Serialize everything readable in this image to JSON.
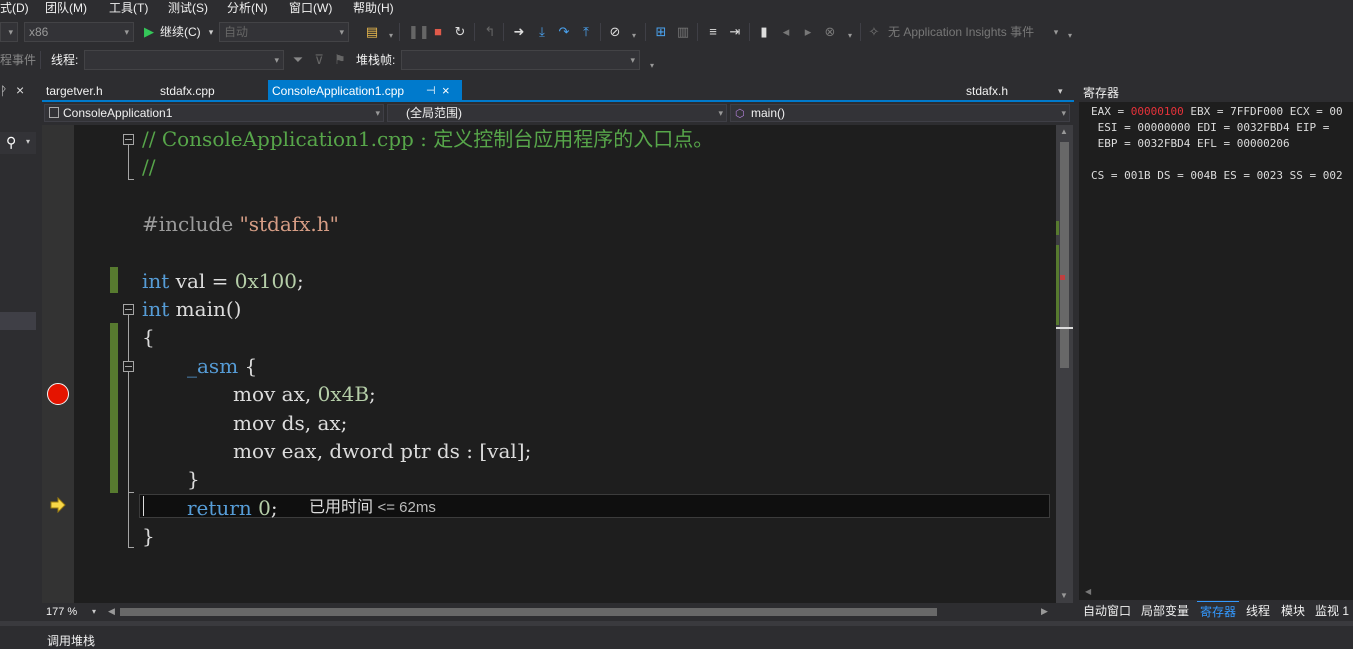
{
  "menu": [
    "式(D)",
    "团队(M)",
    "工具(T)",
    "测试(S)",
    "分析(N)",
    "窗口(W)",
    "帮助(H)"
  ],
  "toolbar": {
    "platform": "x86",
    "continue_label": "继续(C)",
    "config_placeholder": "自动",
    "insights_label": "无 Application Insights 事件"
  },
  "toolbar2": {
    "events_label": "程事件",
    "thread_label": "线程:",
    "stackframe_label": "堆栈帧:"
  },
  "tabs": {
    "items": [
      "targetver.h",
      "stdafx.cpp",
      "ConsoleApplication1.cpp"
    ],
    "active_pin": "⊣",
    "active_close": "×",
    "right_tab": "stdafx.h"
  },
  "nav": {
    "project": "ConsoleApplication1",
    "scope": "(全局范围)",
    "member": "main()"
  },
  "code": {
    "l1_comment": "// ConsoleApplication1.cpp : 定义控制台应用程序的入口点。",
    "l2_comment": "//",
    "l3_include": "#include",
    "l3_file": "\"stdafx.h\"",
    "l4_type": "int",
    "l4_rest": " val = ",
    "l4_num": "0x100",
    "l4_end": ";",
    "l5_type": "int",
    "l5_rest": " main()",
    "l6": "{",
    "l7_kw": "_asm",
    "l7_rest": " {",
    "l8_a": "mov ax, ",
    "l8_num": "0x4B",
    "l8_end": ";",
    "l9": "mov ds, ax;",
    "l10": "mov eax, dword ptr ds : [val];",
    "l11": "}",
    "l12_kw": "return",
    "l12_num": "0",
    "l12_end": ";",
    "l13": "}",
    "perf_tip": "已用时间",
    "perf_ms": "<= 62ms"
  },
  "zoom": "177 %",
  "registers": {
    "title": "寄存器",
    "line1_a": "EAX = ",
    "line1_eax": "00000100",
    "line1_b": " EBX = 7FFDF000 ECX = 00",
    "line2": " ESI = 00000000 EDI = 0032FBD4 EIP =",
    "line3": " EBP = 0032FBD4 EFL = 00000206",
    "line4": "CS = 001B DS = 004B ES = 0023 SS = 002"
  },
  "debug_tabs": [
    "自动窗口",
    "局部变量",
    "寄存器",
    "线程",
    "模块",
    "监视 1"
  ],
  "bottom_tab": "调用堆栈",
  "colors": {
    "accent": "#007acc",
    "breakpoint": "#e51400",
    "changed_register": "#e5323a"
  }
}
